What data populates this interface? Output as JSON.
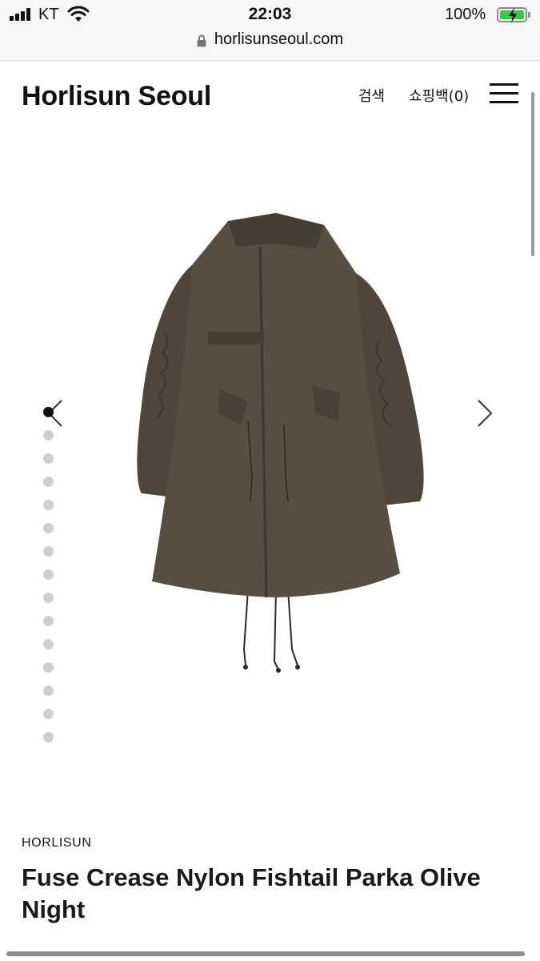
{
  "status_bar": {
    "carrier": "KT",
    "time": "22:03",
    "battery_percent": "100%",
    "signal_icon": "cellular-signal-icon",
    "wifi_icon": "wifi-icon",
    "battery_icon": "battery-charging-icon"
  },
  "browser": {
    "url": "horlisunseoul.com",
    "lock_icon": "lock-icon"
  },
  "header": {
    "logo": "Horlisun Seoul",
    "search_label": "검색",
    "bag_label": "쇼핑백(0)",
    "menu_icon": "hamburger-menu-icon"
  },
  "gallery": {
    "image_count": 15,
    "current_index": 1,
    "image_subject": "olive fishtail parka",
    "image_color": "#554a3d",
    "prev_icon": "chevron-left-icon",
    "next_icon": "chevron-right-icon"
  },
  "product": {
    "brand": "HORLISUN",
    "title": "Fuse Crease Nylon Fishtail Parka Olive Night"
  }
}
